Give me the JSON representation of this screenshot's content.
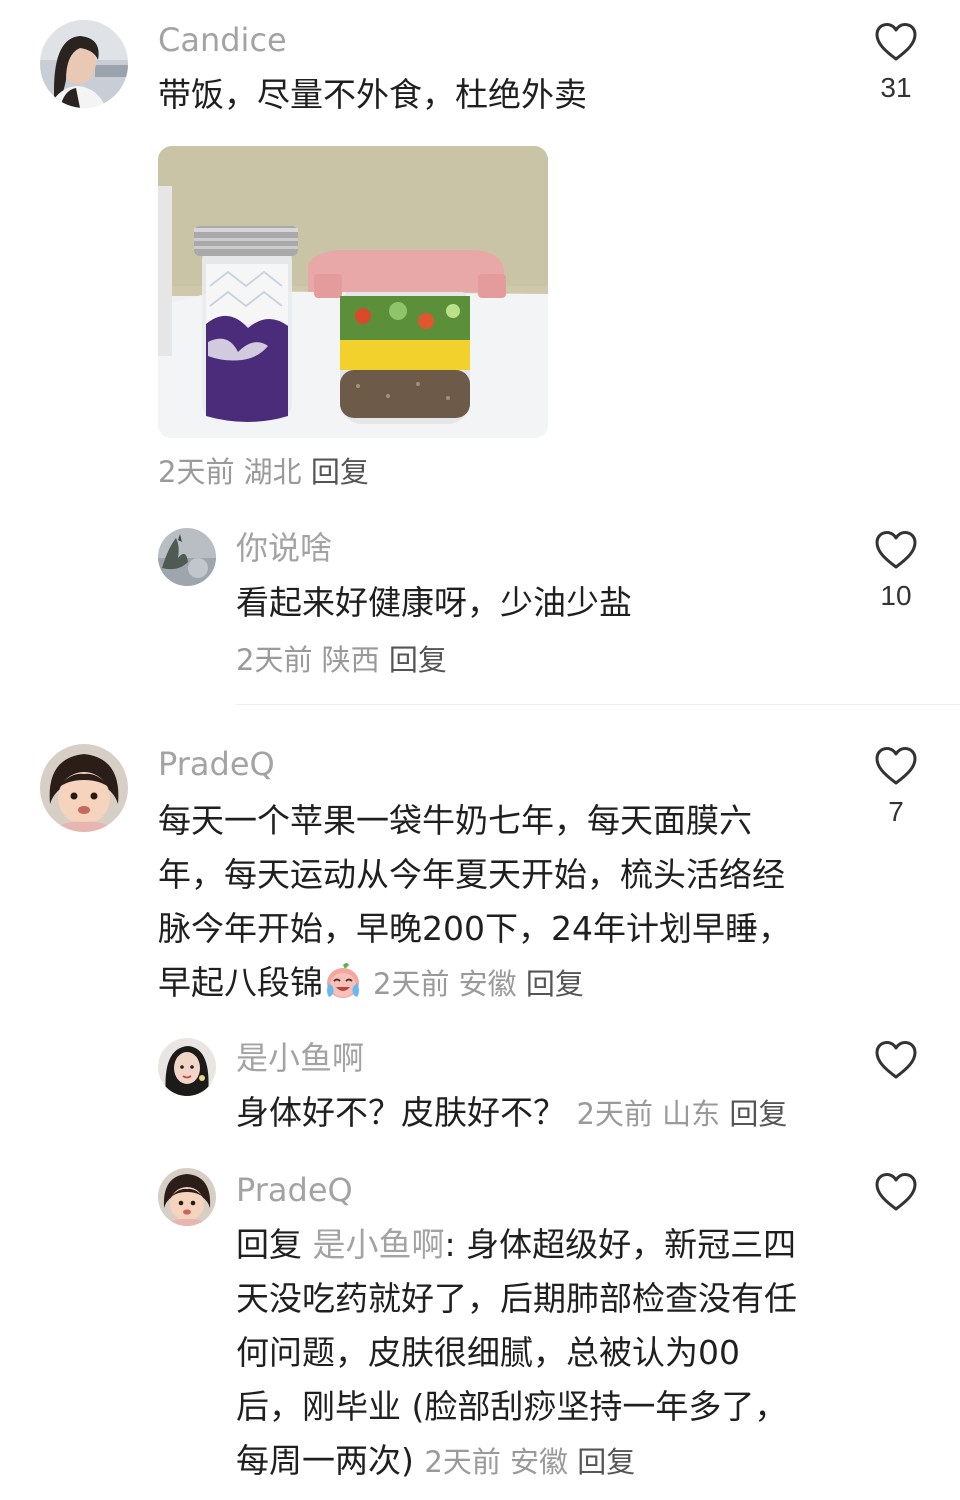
{
  "comments": [
    {
      "user": "Candice",
      "text": "带饭，尽量不外食，杜绝外卖",
      "time": "2天前",
      "location": "湖北",
      "reply_label": "回复",
      "likes": "31",
      "has_photo": true
    },
    {
      "user": "你说啥",
      "text": "看起来好健康呀，少油少盐",
      "time": "2天前",
      "location": "陕西",
      "reply_label": "回复",
      "likes": "10"
    },
    {
      "user": "PradeQ",
      "text_lines": [
        "每天一个苹果一袋牛奶七年，每天面膜六",
        "年，每天运动从今年夏天开始，梳头活络经",
        "脉今年开始，早晚200下，24年计划早睡，",
        "早起八段锦"
      ],
      "time": "2天前",
      "location": "安徽",
      "reply_label": "回复",
      "likes": "7",
      "emoji": "crying-laughing-emoji"
    },
    {
      "user": "是小鱼啊",
      "text": "身体好不？皮肤好不？",
      "time": "2天前",
      "location": "山东",
      "reply_label": "回复",
      "likes": ""
    },
    {
      "user": "PradeQ",
      "reply_prefix": "回复",
      "reply_to": "是小鱼啊",
      "text_lines": [
        ": 身体超级好，新冠三四",
        "天没吃药就好了，后期肺部检查没有任",
        "何问题，皮肤很细腻，总被认为00",
        "后，刚毕业 (脸部刮痧坚持一年多了，",
        "每周一两次)"
      ],
      "time": "2天前",
      "location": "安徽",
      "reply_label": "回复",
      "likes": ""
    }
  ],
  "icons": {
    "like": "heart-outline-icon"
  },
  "colors": {
    "username": "#a3a3a3",
    "body_text": "#1f1f1f",
    "meta": "#9a9a9a"
  }
}
